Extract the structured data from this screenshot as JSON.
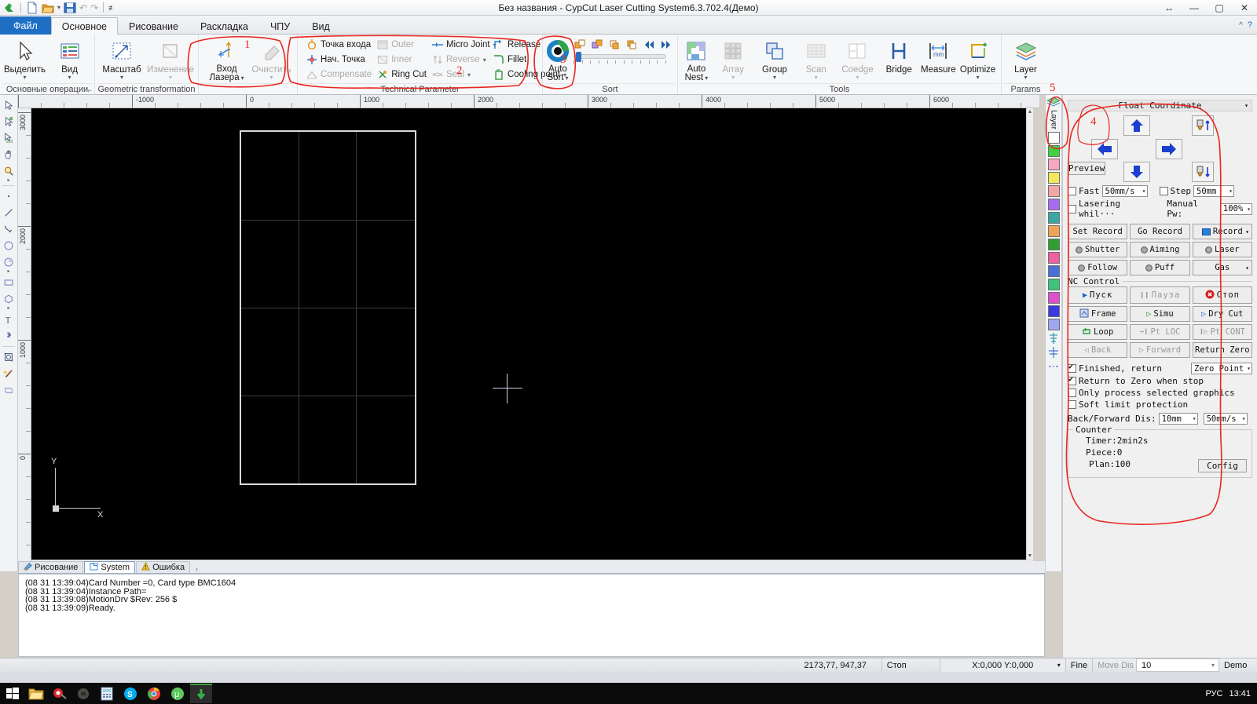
{
  "window": {
    "title": "Без названия - CypCut Laser Cutting System6.3.702.4(Демо)",
    "minimize": "—",
    "maximize": "▢",
    "close": "✕",
    "swap_icon": "↔",
    "help_icon": "?",
    "collapse_icon": "^"
  },
  "quick_access": {
    "app_icon": "cypcut-logo-icon",
    "new_icon": "new-document-icon",
    "open_icon": "open-folder-icon",
    "open_caret": "▾",
    "save_icon": "save-disk-icon",
    "undo_icon": "↶",
    "redo_icon": "↷",
    "customize_caret": "▾"
  },
  "tabs": [
    {
      "label": "Файл",
      "active": false,
      "file": true
    },
    {
      "label": "Основное",
      "active": true,
      "file": false
    },
    {
      "label": "Рисование",
      "active": false,
      "file": false
    },
    {
      "label": "Раскладка",
      "active": false,
      "file": false
    },
    {
      "label": "ЧПУ",
      "active": false,
      "file": false
    },
    {
      "label": "Вид",
      "active": false,
      "file": false
    }
  ],
  "ribbon": {
    "groups": [
      {
        "label": "Основные операции",
        "has_launcher": true,
        "big_buttons": [
          {
            "label": "Выделить",
            "icon": "cursor-select-icon",
            "caret": "▾",
            "disabled": false
          },
          {
            "label": "Вид",
            "icon": "view-list-icon",
            "caret": "▾",
            "disabled": false
          }
        ]
      },
      {
        "label": "Geometric transformation",
        "has_launcher": false,
        "big_buttons": [
          {
            "label": "Масштаб",
            "icon": "scale-arrow-icon",
            "caret": "▾",
            "disabled": false
          },
          {
            "label": "Изменение",
            "icon": "modify-shape-icon",
            "caret": "▾",
            "disabled": true
          }
        ]
      },
      {
        "label": "",
        "has_launcher": false,
        "big_buttons": [
          {
            "label": "Вход\nЛазера",
            "label_l1": "Вход",
            "label_l2": "Лазера",
            "icon": "laser-entry-icon",
            "caret": "▾",
            "disabled": false
          },
          {
            "label": "Очистить",
            "icon": "eraser-icon",
            "caret": "▾",
            "disabled": true
          }
        ]
      },
      {
        "label": "Technical Parameter",
        "has_launcher": false,
        "small_buttons": [
          {
            "label": "Точка входа",
            "icon": "entry-point-icon",
            "caret": "",
            "disabled": false
          },
          {
            "label": "Нач. Точка",
            "icon": "start-point-icon",
            "caret": "",
            "disabled": false
          },
          {
            "label": "Compensate",
            "icon": "compensate-icon",
            "caret": "",
            "disabled": true
          },
          {
            "label": "Outer",
            "icon": "outer-icon",
            "caret": "",
            "disabled": true
          },
          {
            "label": "Inner",
            "icon": "inner-icon",
            "caret": "",
            "disabled": true
          },
          {
            "label": "Ring Cut",
            "icon": "ring-cut-icon",
            "caret": "",
            "disabled": false
          },
          {
            "label": "Micro Joint",
            "icon": "micro-joint-icon",
            "caret": "▾",
            "disabled": false
          },
          {
            "label": "Reverse",
            "icon": "reverse-icon",
            "caret": "▾",
            "disabled": true
          },
          {
            "label": "Seal",
            "icon": "seal-icon",
            "caret": "▾",
            "disabled": true
          },
          {
            "label": "Release",
            "icon": "release-icon",
            "caret": "",
            "disabled": false
          },
          {
            "label": "Fillet",
            "icon": "fillet-icon",
            "caret": "",
            "disabled": false
          },
          {
            "label": "Cooling point",
            "icon": "cooling-point-icon",
            "caret": "▾",
            "disabled": false
          }
        ]
      },
      {
        "label": "Sort",
        "has_launcher": false,
        "big_buttons": [
          {
            "label": "Auto\nSort",
            "label_l1": "Auto",
            "label_l2": "Sort",
            "icon": "auto-sort-icon",
            "caret": "▾",
            "disabled": false
          }
        ],
        "sort_icons": [
          "sort-forward-one-icon",
          "sort-backward-one-icon",
          "sort-to-front-icon",
          "sort-to-back-icon",
          "sort-first-icon",
          "sort-last-icon"
        ],
        "slider_value": 2
      },
      {
        "label": "Tools",
        "has_launcher": false,
        "big_buttons": [
          {
            "label": "Auto\nNest",
            "label_l1": "Auto",
            "label_l2": "Nest",
            "icon": "auto-nest-icon",
            "caret": "▾",
            "disabled": false
          },
          {
            "label": "Array",
            "icon": "array-grid-icon",
            "caret": "▾",
            "disabled": true
          },
          {
            "label": "Group",
            "icon": "group-shapes-icon",
            "caret": "▾",
            "disabled": false
          },
          {
            "label": "Scan",
            "icon": "scan-icon",
            "caret": "▾",
            "disabled": true
          },
          {
            "label": "Coedge",
            "icon": "coedge-icon",
            "caret": "▾",
            "disabled": true
          },
          {
            "label": "Bridge",
            "icon": "bridge-icon",
            "caret": "",
            "disabled": false
          },
          {
            "label": "Measure",
            "icon": "measure-mm-icon",
            "caret": "",
            "disabled": false
          },
          {
            "label": "Optimize",
            "icon": "optimize-icon",
            "caret": "▾",
            "disabled": false
          }
        ]
      },
      {
        "label": "Params",
        "has_launcher": false,
        "big_buttons": [
          {
            "label": "Layer",
            "icon": "layers-icon",
            "caret": "▾",
            "disabled": false
          }
        ]
      }
    ]
  },
  "left_toolbar": [
    {
      "icon": "select-arrow-icon"
    },
    {
      "icon": "node-edit-icon"
    },
    {
      "icon": "sort-number-icon"
    },
    {
      "icon": "pan-hand-icon"
    },
    {
      "icon": "zoom-magnifier-icon",
      "caret": "▸"
    },
    {
      "sep": true
    },
    {
      "icon": "point-icon"
    },
    {
      "icon": "line-icon"
    },
    {
      "icon": "polyline-icon"
    },
    {
      "icon": "circle-icon"
    },
    {
      "icon": "arc-pie-icon",
      "caret": "▸"
    },
    {
      "icon": "rectangle-icon"
    },
    {
      "icon": "polygon-icon",
      "caret": "▸"
    },
    {
      "icon": "text-tool-icon"
    },
    {
      "icon": "puzzle-shape-icon"
    },
    {
      "sep": true
    },
    {
      "icon": "transform-frame-icon"
    },
    {
      "icon": "magic-wand-icon"
    },
    {
      "icon": "plate-icon"
    }
  ],
  "rulers": {
    "h_labels": [
      "-1000",
      "0",
      "1000",
      "2000",
      "3000",
      "4000",
      "5000",
      "6000"
    ],
    "v_labels": [
      "3000",
      "2000",
      "1000",
      "0"
    ]
  },
  "canvas": {
    "part_name": "rectangular-part-outline",
    "origin_label_x": "X",
    "origin_label_y": "Y"
  },
  "layer_strip": {
    "header_icon": "layers-stack-icon",
    "title": "Layer",
    "swatches": [
      "#ffffff",
      "#3fd23f",
      "#f6a8c0",
      "#f2e85c",
      "#f2a6a6",
      "#a86cf0",
      "#3aa7a3",
      "#f0a355",
      "#2fa02f",
      "#f05fa0",
      "#4a6fd6",
      "#3ec47a",
      "#e04fd0",
      "#3a3ae0",
      "#a0a6f0"
    ],
    "extra_icons": [
      "align-tool-icon",
      "align-center-icon",
      "dashed-line-icon"
    ]
  },
  "nc_panel": {
    "coord_header": "Float Coordinate",
    "coord_header_caret": "▾",
    "number_annotation": "4",
    "pad": {
      "up_icon": "arrow-up-icon",
      "down_icon": "arrow-down-icon",
      "left_icon": "arrow-left-icon",
      "right_icon": "arrow-right-icon",
      "nozzle_up_icon": "nozzle-up-icon",
      "nozzle_down_icon": "nozzle-down-icon",
      "preview_label": "Preview"
    },
    "fast": {
      "label": "Fast",
      "checked": false,
      "value": "50mm/s",
      "caret": "▾"
    },
    "step": {
      "label": "Step",
      "checked": false,
      "value": "50mm",
      "caret": "▾"
    },
    "lasering": {
      "label": "Lasering whil···",
      "checked": false
    },
    "manual_power": {
      "label": "Manual Pw:",
      "value": "100%",
      "caret": "▾"
    },
    "record_buttons": [
      {
        "label": "Set Record",
        "icon": "",
        "dropdown": false,
        "disabled": false
      },
      {
        "label": "Go Record",
        "icon": "",
        "dropdown": false,
        "disabled": false
      },
      {
        "label": "Record",
        "icon": "record-blue-icon",
        "dropdown": true,
        "caret": "▾",
        "disabled": false
      }
    ],
    "toggle_buttons": [
      {
        "label": "Shutter",
        "dot": true,
        "dropdown": false,
        "disabled": false
      },
      {
        "label": "Aiming",
        "dot": true,
        "dropdown": false,
        "disabled": false
      },
      {
        "label": "Laser",
        "dot": true,
        "dropdown": false,
        "disabled": false
      },
      {
        "label": "Follow",
        "dot": true,
        "dropdown": false,
        "disabled": false
      },
      {
        "label": "Puff",
        "dot": true,
        "dropdown": false,
        "disabled": false
      },
      {
        "label": "Gas",
        "dot": false,
        "dropdown": true,
        "caret": "▾",
        "disabled": false
      }
    ],
    "nc_control_label": "NC Control",
    "nc_buttons": [
      {
        "label": "Пуск",
        "icon": "play-icon",
        "disabled": false
      },
      {
        "label": "Пауза",
        "icon": "pause-icon",
        "disabled": true
      },
      {
        "label": "Стоп",
        "icon": "stop-red-icon",
        "disabled": false
      },
      {
        "label": "Frame",
        "icon": "frame-icon",
        "disabled": false
      },
      {
        "label": "Simu",
        "icon": "simulate-icon",
        "disabled": false
      },
      {
        "label": "Dry Cut",
        "icon": "dry-cut-icon",
        "disabled": false
      },
      {
        "label": "Loop",
        "icon": "loop-icon",
        "disabled": false
      },
      {
        "label": "Pt LOC",
        "icon": "point-loc-icon",
        "disabled": true
      },
      {
        "label": "Pt CONT",
        "icon": "point-cont-icon",
        "disabled": true
      },
      {
        "label": "Back",
        "icon": "back-icon",
        "disabled": true
      },
      {
        "label": "Forward",
        "icon": "forward-icon",
        "disabled": true
      },
      {
        "label": "Return Zero",
        "icon": "",
        "disabled": false
      }
    ],
    "options": [
      {
        "label": "Finished, return",
        "checked": true,
        "combo": "Zero Point",
        "combo_caret": "▾"
      },
      {
        "label": "Return to Zero when stop",
        "checked": true
      },
      {
        "label": "Only process selected graphics",
        "checked": false
      },
      {
        "label": "Soft limit protection",
        "checked": false
      }
    ],
    "back_forward": {
      "label": "Back/Forward Dis:",
      "dist": "10mm",
      "dist_caret": "▾",
      "speed": "50mm/s",
      "speed_caret": "▾"
    },
    "counter": {
      "title": "Counter",
      "timer_label": "Timer:",
      "timer_value": "2min2s",
      "piece_label": "Piece:",
      "piece_value": "0",
      "plan_label": "Plan:",
      "plan_value": "100",
      "config_button": "Config"
    }
  },
  "bottom_tabs": [
    {
      "label": "Рисование",
      "icon": "drawing-icon",
      "active": false
    },
    {
      "label": "System",
      "icon": "system-icon",
      "active": true
    },
    {
      "label": "Ошибка",
      "icon": "warning-icon",
      "active": false
    }
  ],
  "bottom_tabs_more": "‹",
  "log_lines": [
    "(08 31 13:39:04)Card Number =0, Card type BMC1604",
    "(08 31 13:39:04)Instance Path=",
    "(08 31 13:39:08)MotionDrv $Rev: 256 $",
    "(08 31 13:39:09)Ready."
  ],
  "status_bar": {
    "coords": "2173,77, 947,37",
    "state": "Стоп",
    "machine_coords": "X:0,000 Y:0,000",
    "machine_caret": "▾",
    "fine": "Fine",
    "move_dis_label": "Move Dis",
    "move_dis_value": "10",
    "move_dis_caret": "▾",
    "demo": "Demo"
  },
  "taskbar": {
    "start_icon": "windows-start-icon",
    "items": [
      {
        "icon": "explorer-folder-icon",
        "active": false
      },
      {
        "icon": "app-red-icon",
        "active": false
      },
      {
        "icon": "wot-tank-icon",
        "active": false
      },
      {
        "icon": "calculator-icon",
        "active": false
      },
      {
        "icon": "skype-icon",
        "active": false
      },
      {
        "icon": "chrome-icon",
        "active": false
      },
      {
        "icon": "utorrent-icon",
        "active": false
      },
      {
        "icon": "cypcut-icon",
        "active": true
      }
    ],
    "tray": {
      "language": "РУС",
      "clock": "13:41"
    }
  },
  "annotations": {
    "color": "#e8271f",
    "numbers": [
      "1",
      "2",
      "3",
      "4",
      "5"
    ]
  }
}
